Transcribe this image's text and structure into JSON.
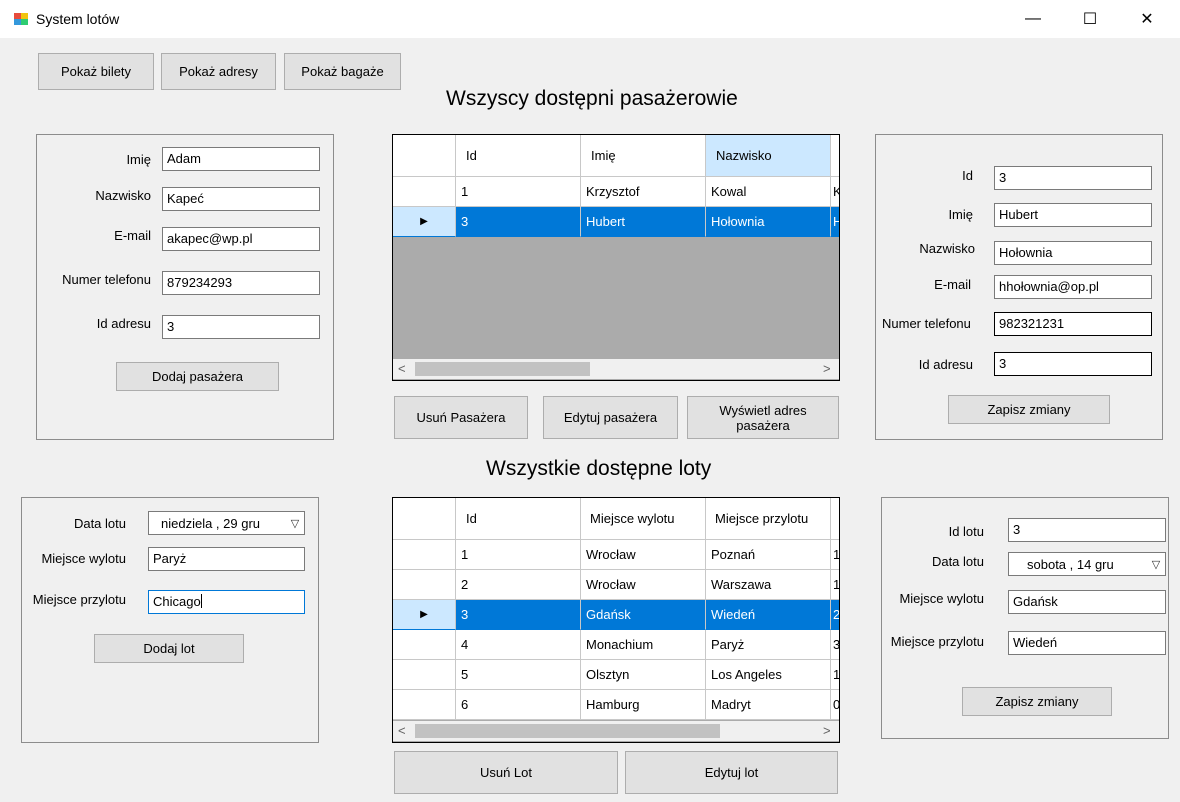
{
  "window": {
    "title": "System lotów",
    "controls": {
      "minimize": "—",
      "maximize": "☐",
      "close": "✕"
    }
  },
  "toolbar": {
    "show_tickets": "Pokaż bilety",
    "show_addresses": "Pokaż adresy",
    "show_baggage": "Pokaż bagaże"
  },
  "passengers": {
    "heading": "Wszyscy dostępni pasażerowie",
    "add_form": {
      "first_name_label": "Imię",
      "first_name": "Adam",
      "last_name_label": "Nazwisko",
      "last_name": "Kapeć",
      "email_label": "E-mail",
      "email": "akapec@wp.pl",
      "phone_label": "Numer telefonu",
      "phone": "879234293",
      "address_id_label": "Id adresu",
      "address_id": "3",
      "add_button": "Dodaj pasażera"
    },
    "grid": {
      "columns": [
        "Id",
        "Imię",
        "Nazwisko"
      ],
      "rows": [
        {
          "id": "1",
          "first_name": "Krzysztof",
          "last_name": "Kowal",
          "extra": "K"
        },
        {
          "id": "3",
          "first_name": "Hubert",
          "last_name": "Hołownia",
          "extra": "H"
        }
      ]
    },
    "delete_button": "Usuń Pasażera",
    "edit_button": "Edytuj pasażera",
    "show_address_button": "Wyświetl adres pasażera",
    "edit_form": {
      "id_label": "Id",
      "id": "3",
      "first_name_label": "Imię",
      "first_name": "Hubert",
      "last_name_label": "Nazwisko",
      "last_name": "Hołownia",
      "email_label": "E-mail",
      "email": "hhołownia@op.pl",
      "phone_label": "Numer telefonu",
      "phone": "982321231",
      "address_id_label": "Id adresu",
      "address_id": "3",
      "save_button": "Zapisz zmiany"
    }
  },
  "flights": {
    "heading": "Wszystkie dostępne loty",
    "add_form": {
      "date_label": "Data lotu",
      "date": "niedziela   ,  29     gru",
      "from_label": "Miejsce wylotu",
      "from": "Paryż",
      "to_label": "Miejsce przylotu",
      "to": "Chicago",
      "add_button": "Dodaj lot"
    },
    "grid": {
      "columns": [
        "Id",
        "Miejsce wylotu",
        "Miejsce przylotu"
      ],
      "rows": [
        {
          "id": "1",
          "from": "Wrocław",
          "to": "Poznań",
          "extra": "1"
        },
        {
          "id": "2",
          "from": "Wrocław",
          "to": "Warszawa",
          "extra": "1"
        },
        {
          "id": "3",
          "from": "Gdańsk",
          "to": "Wiedeń",
          "extra": "2"
        },
        {
          "id": "4",
          "from": "Monachium",
          "to": "Paryż",
          "extra": "3"
        },
        {
          "id": "5",
          "from": "Olsztyn",
          "to": "Los Angeles",
          "extra": "1"
        },
        {
          "id": "6",
          "from": "Hamburg",
          "to": "Madryt",
          "extra": "0"
        }
      ]
    },
    "delete_button": "Usuń Lot",
    "edit_button": "Edytuj lot",
    "edit_form": {
      "id_label": "Id lotu",
      "id": "3",
      "date_label": "Data lotu",
      "date": "sobota     ,  14     gru",
      "from_label": "Miejsce wylotu",
      "from": "Gdańsk",
      "to_label": "Miejsce przylotu",
      "to": "Wiedeń",
      "save_button": "Zapisz zmiany"
    }
  }
}
